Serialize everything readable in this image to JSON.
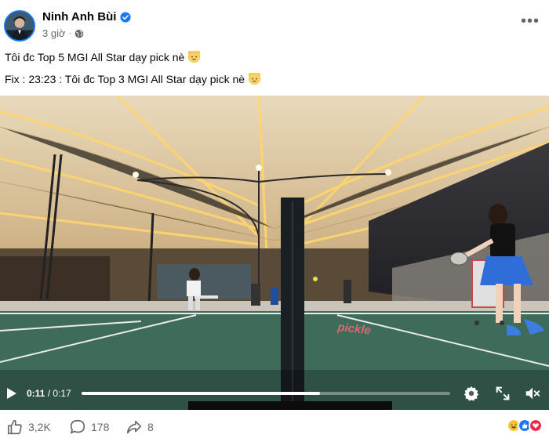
{
  "post": {
    "author_name": "Ninh Anh Bùi",
    "timestamp": "3 giờ",
    "separator": "·",
    "line1": "Tôi đc Top 5 MGI All Star dạy pick nè",
    "line2": "Fix : 23:23 : Tôi đc Top 3 MGI All Star dạy pick nè",
    "more_label": "•••"
  },
  "video": {
    "current_time": "0:11",
    "time_separator": " / ",
    "duration": "0:17",
    "progress_fraction": 0.647,
    "court_text": "pickle"
  },
  "engagement": {
    "likes": "3,2K",
    "comments": "178",
    "shares": "8"
  },
  "icons": {
    "verified": "verified-badge-icon",
    "privacy": "globe-icon",
    "more": "more-options-icon",
    "play": "play-icon",
    "settings": "gear-icon",
    "fullscreen": "expand-icon",
    "volume": "mute-icon",
    "like": "thumbs-up-icon",
    "comment": "comment-icon",
    "share": "share-icon"
  },
  "colors": {
    "accent": "#1877f2",
    "muted_text": "#65676b",
    "court": "#3f6b5b"
  }
}
